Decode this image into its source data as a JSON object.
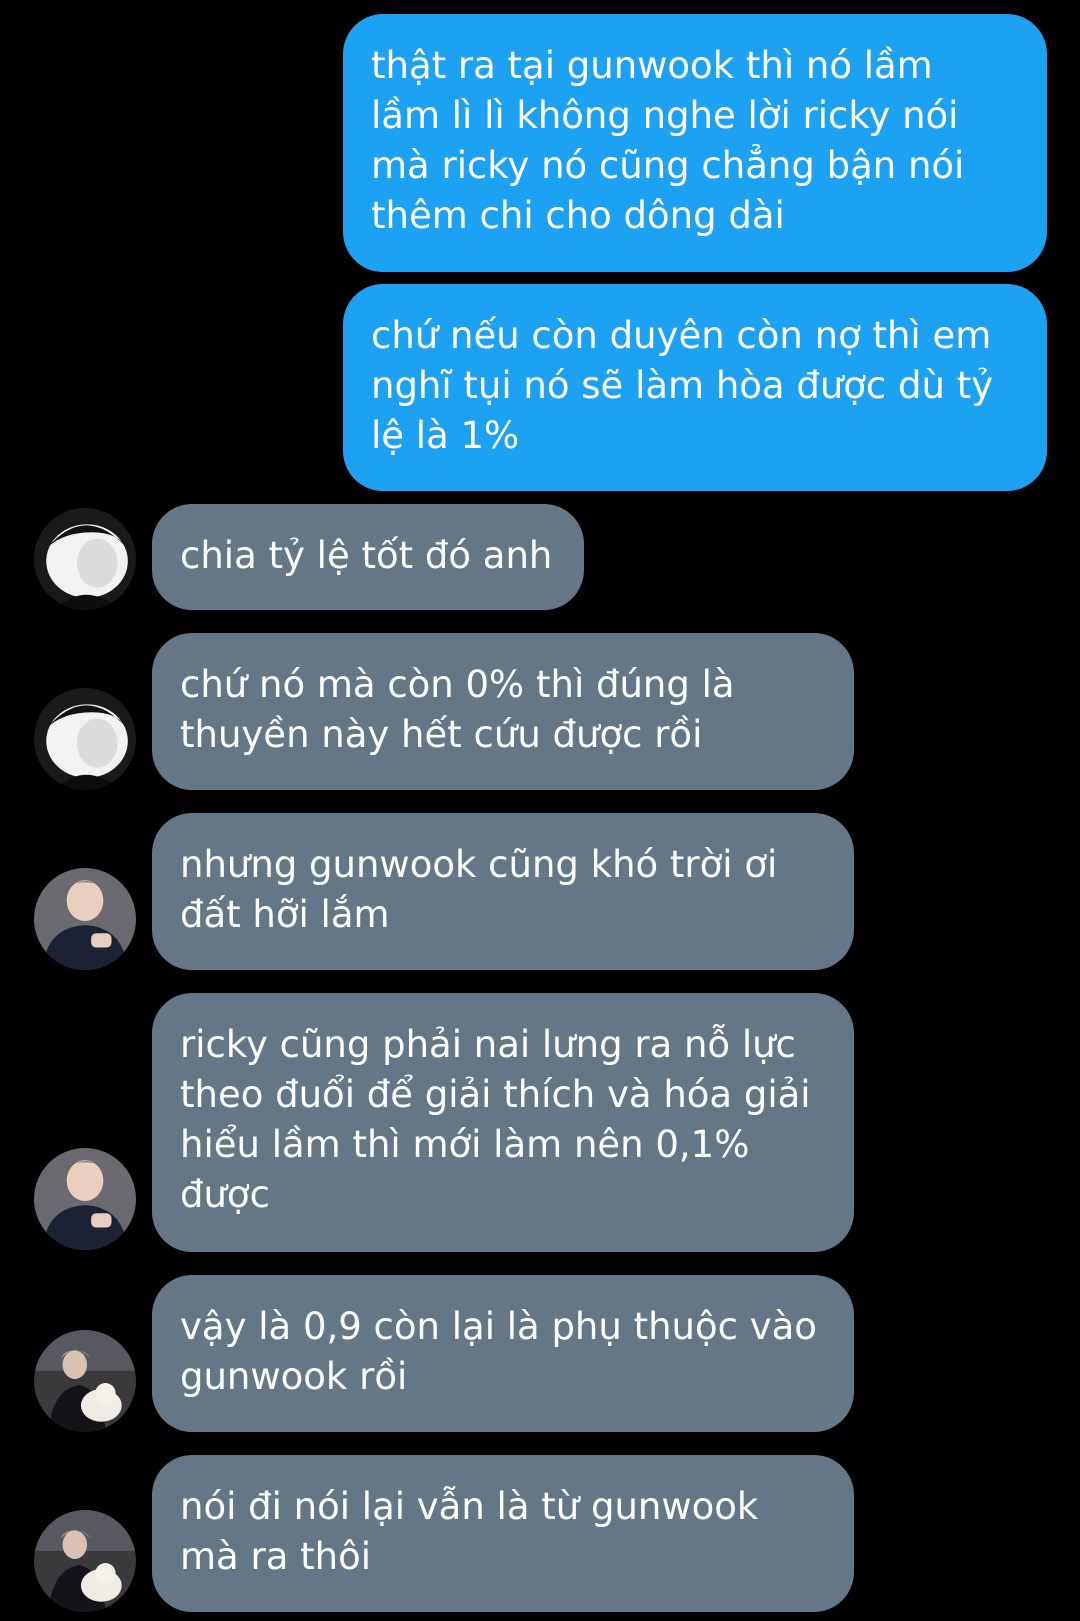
{
  "messages": [
    {
      "side": "sent",
      "lines": [
        "thật ra tại gunwook thì nó lầm",
        "lầm lì lì không nghe lời ricky nói",
        "mà ricky nó cũng chẳng bận nói",
        "thêm chi cho dông dài"
      ]
    },
    {
      "side": "sent",
      "lines": [
        "chứ nếu còn duyên còn nợ thì em",
        "nghĩ tụi nó sẽ làm hòa được dù tỷ",
        "lệ là 1%"
      ]
    },
    {
      "side": "recv",
      "avatar": "avatar-bw-portrait-icon",
      "lines": [
        "chia tỷ lệ tốt đó anh"
      ]
    },
    {
      "side": "recv",
      "avatar": "avatar-bw-portrait-icon",
      "lines": [
        "chứ nó mà còn 0% thì đúng là",
        "thuyền này hết cứu được rồi"
      ]
    },
    {
      "side": "recv",
      "avatar": "avatar-dark-suit-icon",
      "lines": [
        "nhưng gunwook cũng khó trời ơi",
        "đất hỡi lắm"
      ]
    },
    {
      "side": "recv",
      "avatar": "avatar-dark-suit-icon",
      "lines": [
        "ricky cũng phải nai lưng ra nỗ lực",
        "theo đuổi để giải thích và hóa giải",
        "hiểu lầm thì mới làm nên 0,1%",
        "được"
      ]
    },
    {
      "side": "recv",
      "avatar": "avatar-with-dog-icon",
      "lines": [
        "vậy là 0,9 còn lại là phụ thuộc vào",
        "gunwook rồi"
      ]
    },
    {
      "side": "recv",
      "avatar": "avatar-with-dog-icon",
      "lines": [
        "nói đi nói lại vẫn là từ gunwook",
        "mà ra thôi"
      ]
    }
  ],
  "colors": {
    "background": "#000000",
    "sent_bubble": "#1da1f2",
    "received_bubble": "#657786",
    "text": "#ffffff"
  }
}
